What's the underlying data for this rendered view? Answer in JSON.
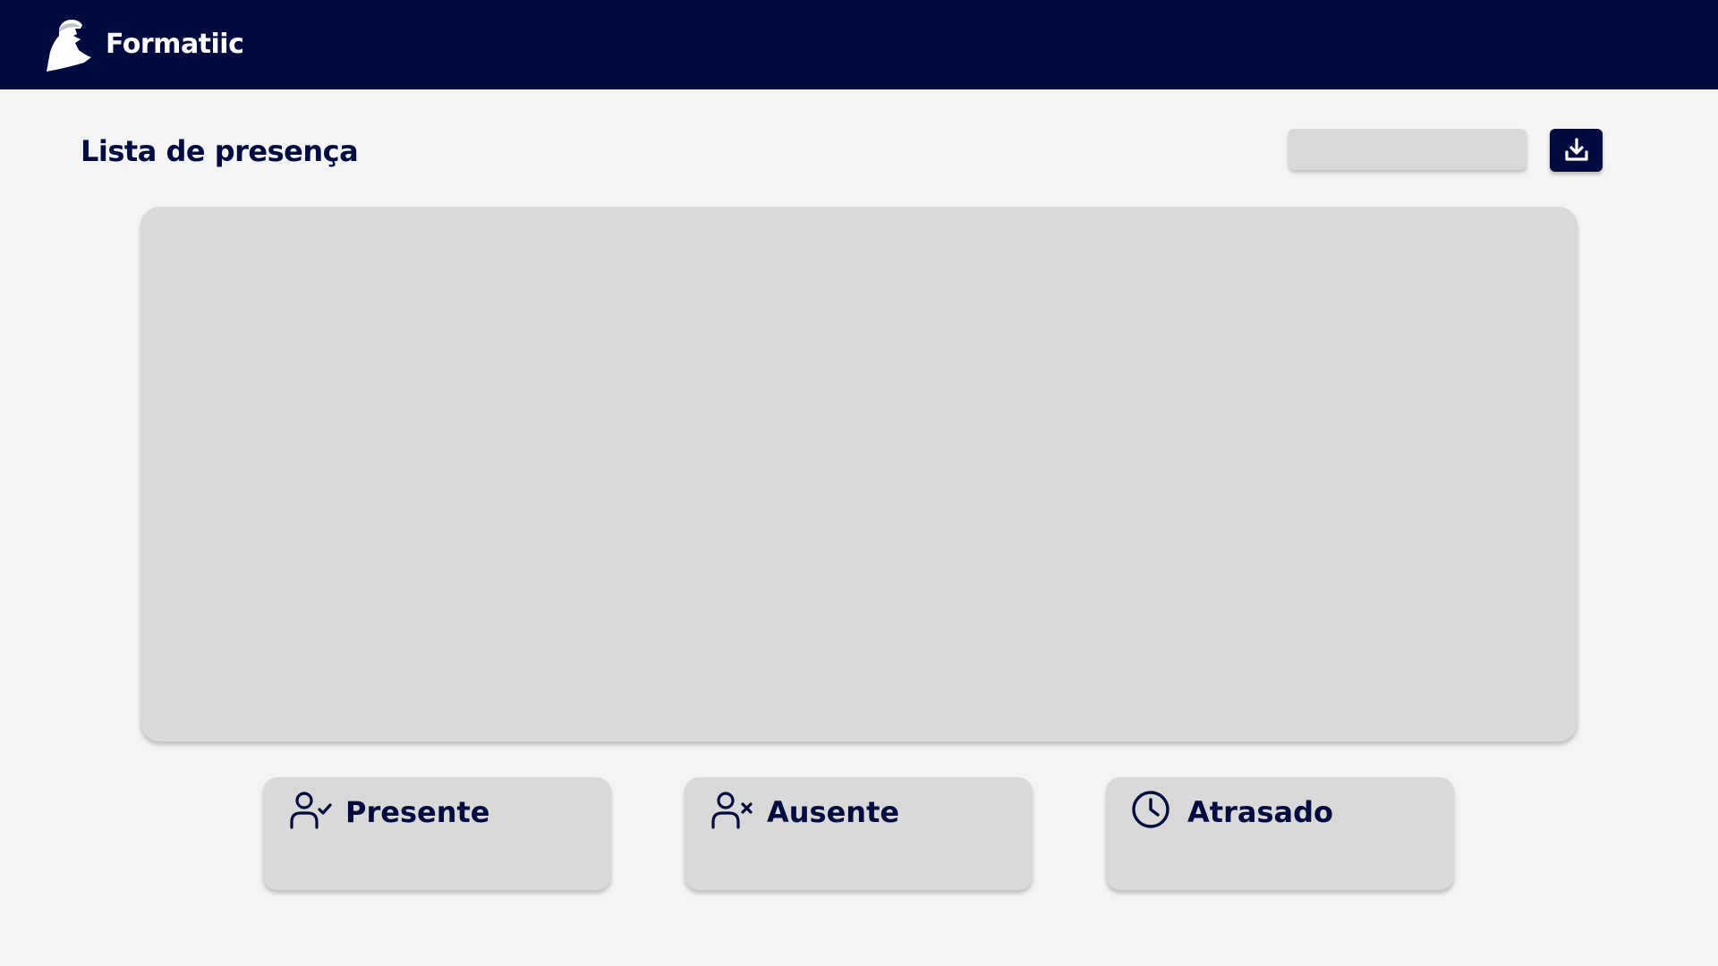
{
  "header": {
    "app_name": "Formatiic",
    "logo_icon": "scholar-silhouette-logo",
    "background_color": "#000c40"
  },
  "page": {
    "title": "Lista de presença",
    "date_field_value": "",
    "download_icon": "download-icon"
  },
  "status_cards": [
    {
      "label": "Presente",
      "icon": "user-check-icon"
    },
    {
      "label": "Ausente",
      "icon": "user-x-icon"
    },
    {
      "label": "Atrasado",
      "icon": "clock-icon"
    }
  ],
  "colors": {
    "primary": "#000c40",
    "background": "#f4f4f4",
    "panel": "#d9d9d9"
  }
}
